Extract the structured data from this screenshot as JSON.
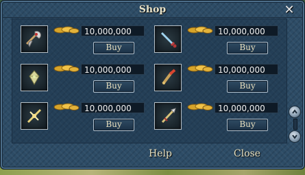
{
  "window": {
    "title": "Shop",
    "close_icon": "close-icon"
  },
  "items": [
    {
      "icon": "axe-icon",
      "price": "10,000,000",
      "buy_label": "Buy"
    },
    {
      "icon": "sword-icon",
      "price": "10,000,000",
      "buy_label": "Buy"
    },
    {
      "icon": "gem-icon",
      "price": "10,000,000",
      "buy_label": "Buy"
    },
    {
      "icon": "dagger-icon",
      "price": "10,000,000",
      "buy_label": "Buy"
    },
    {
      "icon": "crossbow-icon",
      "price": "10,000,000",
      "buy_label": "Buy"
    },
    {
      "icon": "spear-icon",
      "price": "10,000,000",
      "buy_label": "Buy"
    }
  ],
  "currency_icon": "gold-coin-icon",
  "footer": {
    "help_label": "Help",
    "close_label": "Close"
  },
  "colors": {
    "panel": "#2d4c66",
    "text_gold": "#e9e1bf",
    "price_text": "#f2f2f2"
  }
}
